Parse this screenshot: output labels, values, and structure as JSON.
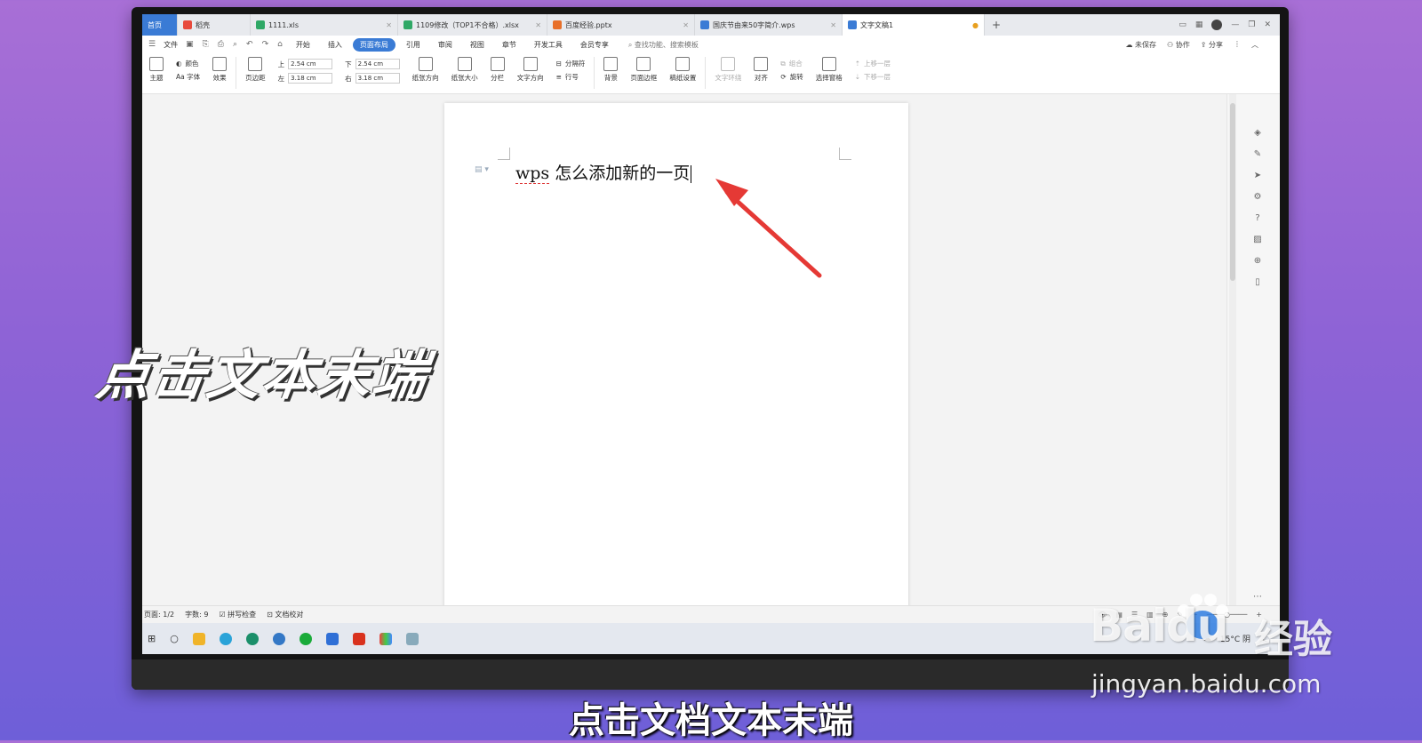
{
  "tabs": [
    {
      "label": "首页",
      "color": "#3a7bd5"
    },
    {
      "label": "稻壳",
      "color": "#e84a3c"
    },
    {
      "label": "1111.xls",
      "color": "#2fa866"
    },
    {
      "label": "1109修改（TOP1不合格）.xlsx",
      "color": "#2fa866"
    },
    {
      "label": "百度经验.pptx",
      "color": "#e8702a"
    },
    {
      "label": "国庆节由来50字简介.wps",
      "color": "#3a7bd5"
    },
    {
      "label": "文字文稿1",
      "color": "#3a7bd5"
    }
  ],
  "menubar": {
    "file": "文件",
    "items": [
      "开始",
      "插入",
      "页面布局",
      "引用",
      "审阅",
      "视图",
      "章节",
      "开发工具",
      "会员专享"
    ],
    "selected": "页面布局",
    "search": "查找功能、搜索模板",
    "unsaved": "未保存",
    "collab": "协作",
    "share": "分享"
  },
  "ribbon": {
    "theme": "主题",
    "color": "颜色",
    "font": "Aa 字体",
    "effect": "效果",
    "margins": "页边距",
    "top_label": "上",
    "top_value": "2.54 cm",
    "bottom_label": "下",
    "bottom_value": "2.54 cm",
    "left_label": "左",
    "left_value": "3.18 cm",
    "right_label": "右",
    "right_value": "3.18 cm",
    "orientation": "纸张方向",
    "size": "纸张大小",
    "columns": "分栏",
    "text_direction": "文字方向",
    "break": "分隔符",
    "line_numbers": "行号",
    "background": "背景",
    "page_border": "页面边框",
    "manuscript": "稿纸设置",
    "wrap": "文字环绕",
    "align": "对齐",
    "group": "组合",
    "rotate": "旋转",
    "select_pane": "选择窗格",
    "bring_forward": "上移一层",
    "send_backward": "下移一层"
  },
  "document": {
    "text_prefix": "wps",
    "text_rest": " 怎么添加新的一页"
  },
  "statusbar": {
    "page": "页面: 1/2",
    "words": "字数: 9",
    "spell": "拼写检查",
    "proof": "文档校对"
  },
  "taskbar": {
    "weather": "15°C 阴"
  },
  "overlay_caption": "点击文本末端",
  "subtitle": "点击文档文本末端",
  "watermark": {
    "logo": "Baidu",
    "cn": "经验",
    "url": "jingyan.baidu.com"
  },
  "arrow_color": "#e53935"
}
